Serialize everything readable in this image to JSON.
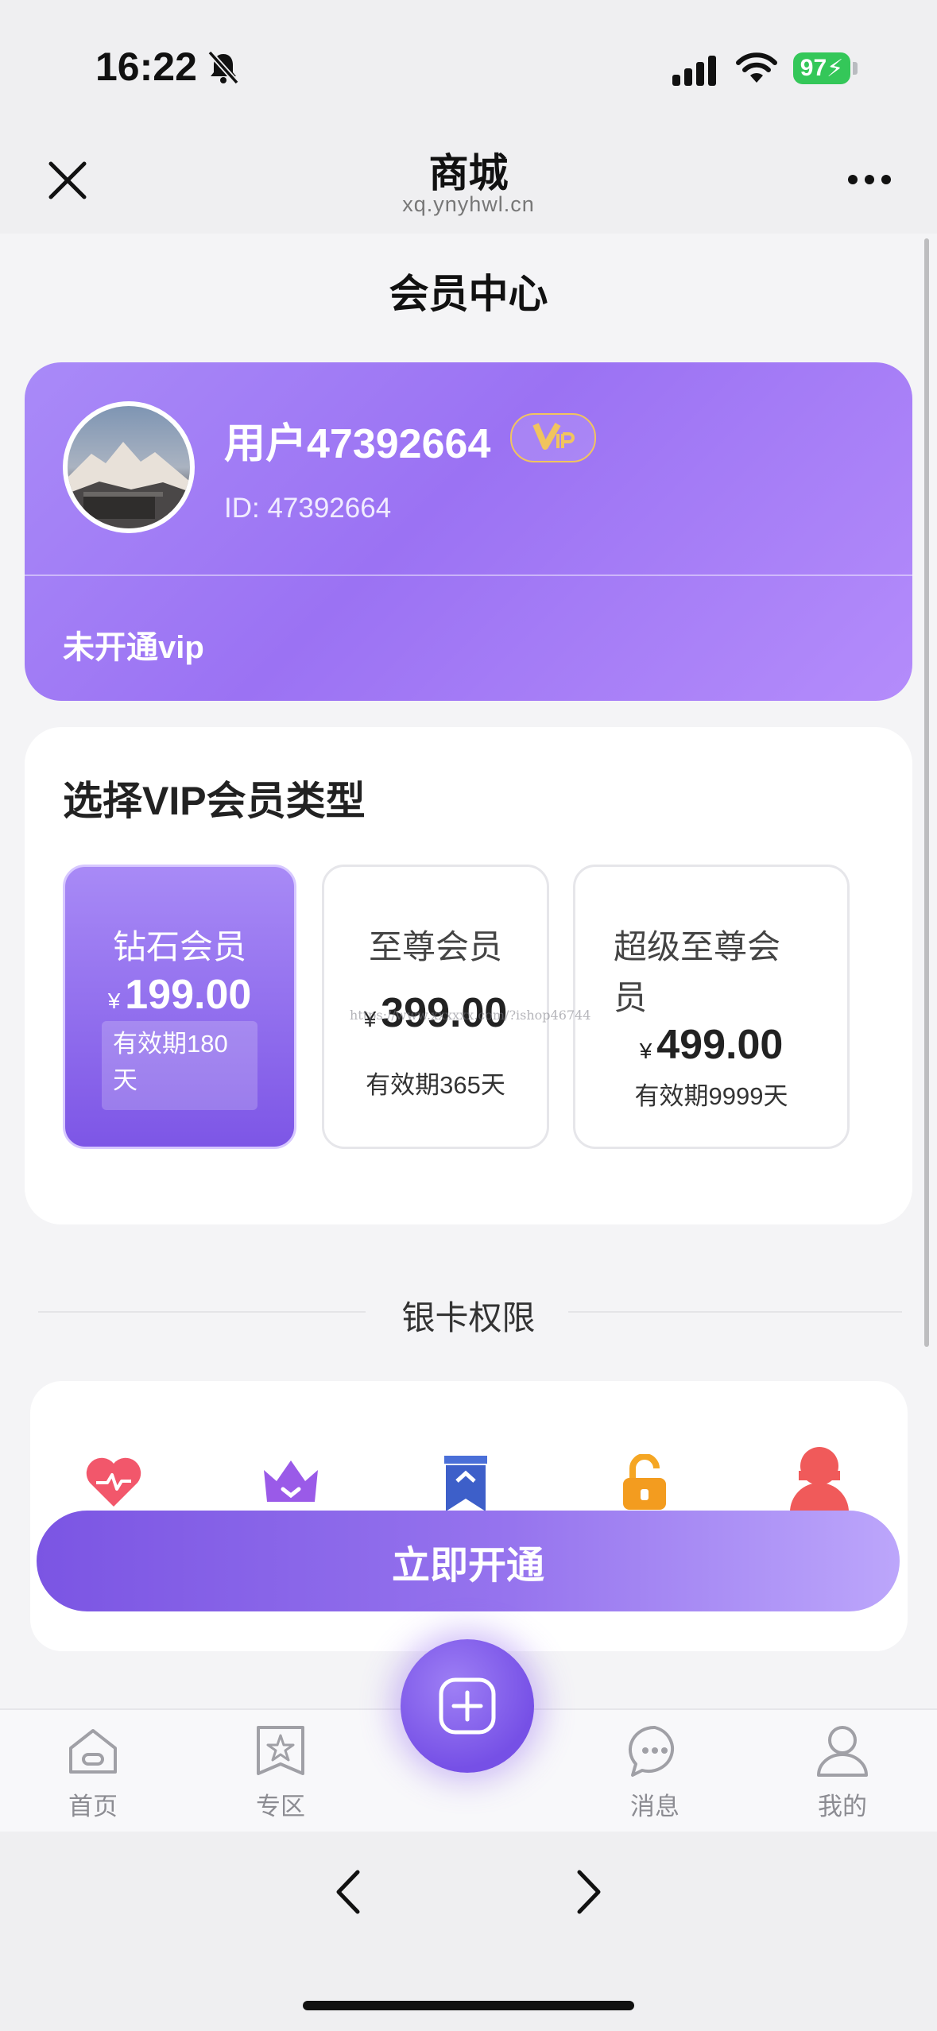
{
  "status_bar": {
    "time": "16:22",
    "battery": "97"
  },
  "nav": {
    "title": "商城",
    "url": "xq.ynyhwl.cn"
  },
  "page": {
    "title": "会员中心"
  },
  "profile": {
    "username": "用户47392664",
    "user_id": "ID: 47392664",
    "vip_status": "未开通vip"
  },
  "vip_select": {
    "title": "选择VIP会员类型",
    "plans": [
      {
        "name": "钻石会员",
        "currency": "¥",
        "price": "199.00",
        "validity_line1": "有效期180",
        "validity_line2": "天",
        "selected": true
      },
      {
        "name": "至尊会员",
        "currency": "¥",
        "price": "399.00",
        "validity": "有效期365天",
        "selected": false
      },
      {
        "name_line1": "超级至尊会",
        "name_line2": "员",
        "currency": "¥",
        "price": "499.00",
        "validity": "有效期9999天",
        "selected": false
      }
    ]
  },
  "watermark": "https://www.xxxxxx.com/?ishop46744",
  "perks": {
    "title": "银卡权限",
    "icons": [
      "heart-icon",
      "crown-icon",
      "bookmark-icon",
      "unlock-icon",
      "user-icon"
    ]
  },
  "cta": {
    "label": "立即开通"
  },
  "tabbar": {
    "items": [
      {
        "label": "首页",
        "icon": "home-icon"
      },
      {
        "label": "专区",
        "icon": "star-icon"
      },
      {
        "label": "消息",
        "icon": "message-icon"
      },
      {
        "label": "我的",
        "icon": "profile-icon"
      }
    ],
    "fab_icon": "plus-icon"
  },
  "colors": {
    "accent": "#7b55e3",
    "card_purple": "#9b72f3",
    "battery": "#34c759"
  }
}
